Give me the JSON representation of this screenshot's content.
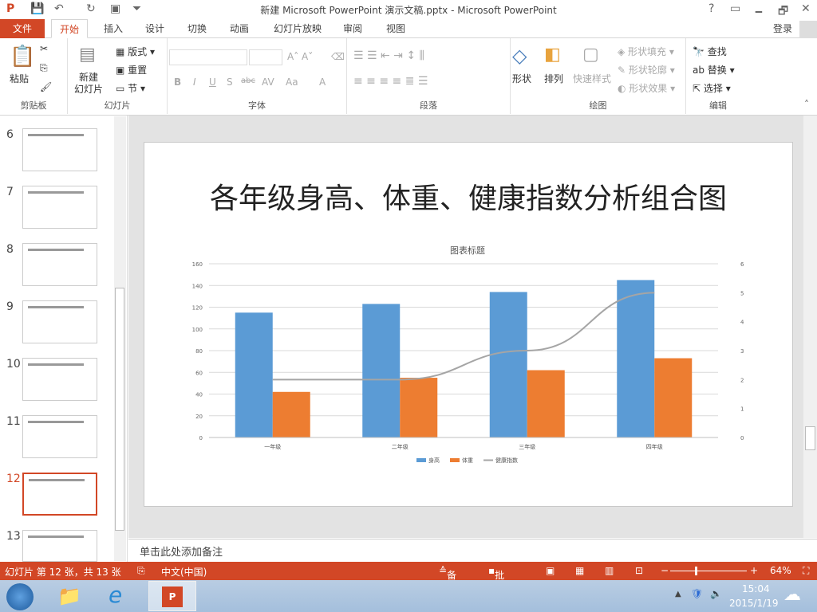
{
  "titlebar": {
    "title": "新建 Microsoft PowerPoint 演示文稿.pptx - Microsoft PowerPoint",
    "help": "?",
    "controls": [
      "🗕",
      "🗗",
      "✕"
    ]
  },
  "tabs": {
    "file": "文件",
    "items": [
      "开始",
      "插入",
      "设计",
      "切换",
      "动画",
      "幻灯片放映",
      "审阅",
      "视图"
    ],
    "signin": "登录"
  },
  "ribbon": {
    "clipboard": {
      "label": "剪贴板",
      "paste": "粘贴"
    },
    "slides": {
      "label": "幻灯片",
      "new_slide": "新建\n幻灯片",
      "layout": "版式",
      "reset": "重置",
      "section": "节"
    },
    "font": {
      "label": "字体",
      "buttons": [
        "B",
        "I",
        "U",
        "S",
        "abc",
        "AV",
        "Aa",
        "A"
      ]
    },
    "paragraph": {
      "label": "段落"
    },
    "drawing": {
      "label": "绘图",
      "shapes": "形状",
      "arrange": "排列",
      "quick_styles": "快速样式",
      "fill": "形状填充",
      "outline": "形状轮廓",
      "effects": "形状效果"
    },
    "editing": {
      "label": "编辑",
      "find": "查找",
      "replace": "替换",
      "select": "选择"
    }
  },
  "thumbnails": [
    {
      "num": "6"
    },
    {
      "num": "7"
    },
    {
      "num": "8"
    },
    {
      "num": "9"
    },
    {
      "num": "10"
    },
    {
      "num": "11"
    },
    {
      "num": "12",
      "selected": true
    },
    {
      "num": "13"
    }
  ],
  "slide": {
    "title": "各年级身高、体重、健康指数分析组合图"
  },
  "chart_data": {
    "type": "bar+line",
    "title": "图表标题",
    "categories": [
      "一年级",
      "二年级",
      "三年级",
      "四年级"
    ],
    "series": [
      {
        "name": "身高",
        "type": "bar",
        "axis": "left",
        "color": "#5b9bd5",
        "values": [
          115,
          123,
          134,
          145
        ]
      },
      {
        "name": "体重",
        "type": "bar",
        "axis": "left",
        "color": "#ed7d31",
        "values": [
          42,
          55,
          62,
          73
        ]
      },
      {
        "name": "健康指数",
        "type": "line",
        "axis": "right",
        "color": "#a5a5a5",
        "values": [
          2,
          2,
          3,
          5
        ]
      }
    ],
    "ylim": [
      0,
      160
    ],
    "yticks": [
      0,
      20,
      40,
      60,
      80,
      100,
      120,
      140,
      160
    ],
    "y2lim": [
      0,
      6
    ],
    "y2ticks": [
      0,
      1,
      2,
      3,
      4,
      5,
      6
    ],
    "grid": true,
    "legend": "bottom"
  },
  "notes": {
    "placeholder": "单击此处添加备注"
  },
  "status": {
    "slide_info": "幻灯片 第 12 张，共 13 张",
    "language": "中文(中国)",
    "notes": "备注",
    "comments": "批注",
    "zoom": "64%",
    "zoom_level": 64
  },
  "taskbar": {
    "time": "15:04",
    "date": "2015/1/19"
  }
}
